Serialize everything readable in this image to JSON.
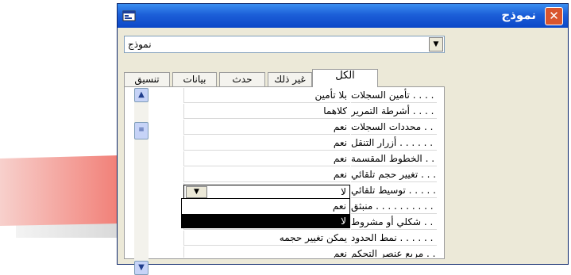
{
  "window": {
    "title": "نموذج",
    "close_icon": "close-icon",
    "app_icon": "form-icon"
  },
  "selector": {
    "value": "نموذج",
    "arrow_icon": "chevron-down-icon"
  },
  "tabs": [
    {
      "label": "الكل",
      "active": true
    },
    {
      "label": "غير ذلك",
      "active": false
    },
    {
      "label": "حدث",
      "active": false
    },
    {
      "label": "بيانات",
      "active": false
    },
    {
      "label": "تنسيق",
      "active": false
    }
  ],
  "properties": [
    {
      "label": "تأمين السجلات . . . . . . . . . .",
      "value": "بلا تأمين"
    },
    {
      "label": "أشرطة التمرير . . . . . . . . .",
      "value": "كلاهما"
    },
    {
      "label": "محددات السجلات . . . . . . . .",
      "value": "نعم"
    },
    {
      "label": "أزرار التنقل . . . . . . . . . . .",
      "value": "نعم"
    },
    {
      "label": "الخطوط المقسمة . . . . . . . .",
      "value": "نعم"
    },
    {
      "label": "تغيير حجم تلقائي . . . . . . .",
      "value": "نعم"
    },
    {
      "label": "توسيط تلقائي . . . . . . . . . .",
      "value": "لا"
    },
    {
      "label": "منبثق . . . . . . . . . . . . . . . .",
      "value": ""
    },
    {
      "label": "شكلي أو مشروط . . . . . . . . .",
      "value": ""
    },
    {
      "label": "نمط الحدود . . . . . . . . . . . .",
      "value": "يمكن تغيير حجمه"
    },
    {
      "label": "مربع عنصر التحكم . . . . . . .",
      "value": "نعم"
    }
  ],
  "dropdown": {
    "options": [
      "نعم",
      "لا"
    ],
    "selected": "لا"
  },
  "colors": {
    "titlebar": "#1c5fd8",
    "close": "#d9552e",
    "arrow_red": "#e8312a"
  }
}
